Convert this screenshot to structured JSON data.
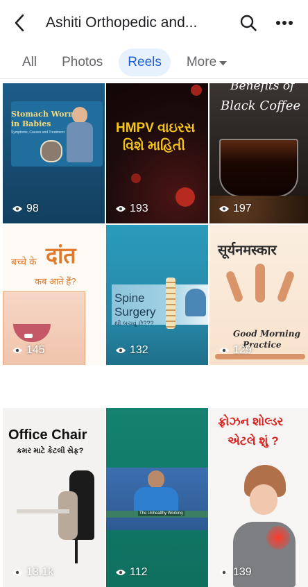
{
  "header": {
    "title": "Ashiti Orthopedic and..."
  },
  "tabs": [
    {
      "label": "All"
    },
    {
      "label": "Photos"
    },
    {
      "label": "Reels"
    },
    {
      "label": "More"
    }
  ],
  "reels": [
    {
      "views": "98",
      "title_line1": "Stomach Worms",
      "title_line2": "in Babies",
      "subtitle": "Symptoms, Causes and Treatment"
    },
    {
      "views": "193",
      "title_line1": "HMPV વાઇરસ",
      "title_line2": "વિશે માહિતી"
    },
    {
      "views": "197",
      "title_line1": "Benefits of",
      "title_line2": "Black Coffee"
    },
    {
      "views": "145",
      "title_line1": "बच्चे के",
      "title_big": "दांत",
      "title_line2": "कब आते हैं?"
    },
    {
      "views": "132",
      "title_line1": "Spine",
      "title_line2": "Surgery",
      "subtitle": "થી બચવું છે???"
    },
    {
      "views": "129",
      "title_line1": "सूर्यनमस्कार",
      "caption_line1": "Good Morning",
      "caption_line2": "Practice"
    },
    {
      "views": "13.1k",
      "title_line1": "Office Chair",
      "title_line2": "કમર માટે કેટલી સેફ?"
    },
    {
      "views": "112",
      "caption": "The Unhealthy Working"
    },
    {
      "views": "139",
      "title_line1": "ફ્રોઝન શોલ્ડર",
      "title_line2": "એટલે શું ?"
    }
  ]
}
